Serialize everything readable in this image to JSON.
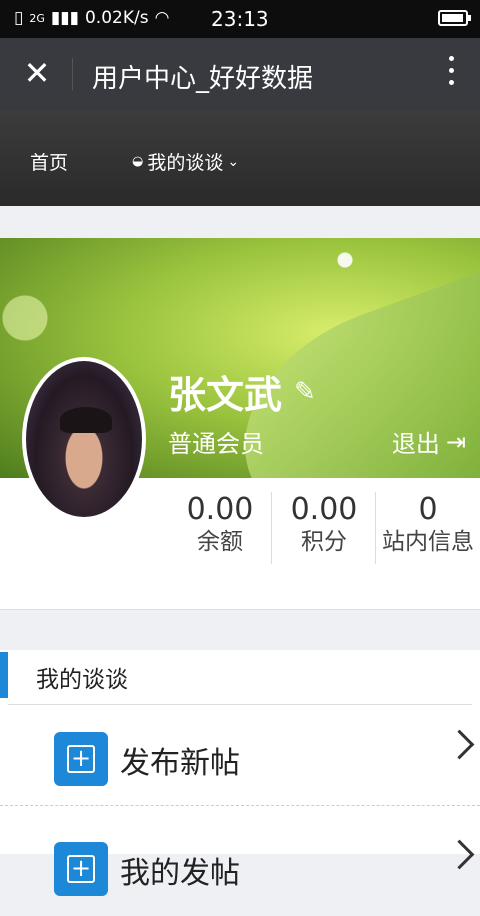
{
  "status": {
    "network": "2G",
    "speed": "0.02K/s",
    "time": "23:13"
  },
  "titlebar": {
    "title": "用户中心_好好数据"
  },
  "nav": {
    "home": "首页",
    "talk": "我的谈谈"
  },
  "profile": {
    "name": "张文武",
    "level": "普通会员",
    "logout": "退出"
  },
  "stats": [
    {
      "value": "0.00",
      "label": "余额"
    },
    {
      "value": "0.00",
      "label": "积分"
    },
    {
      "value": "0",
      "label": "站内信息"
    }
  ],
  "section": {
    "heading": "我的谈谈",
    "items": [
      {
        "label": "发布新帖"
      },
      {
        "label": "我的发帖"
      }
    ]
  },
  "colors": {
    "accent": "#1e88d8",
    "titlebar": "#393a3f"
  }
}
